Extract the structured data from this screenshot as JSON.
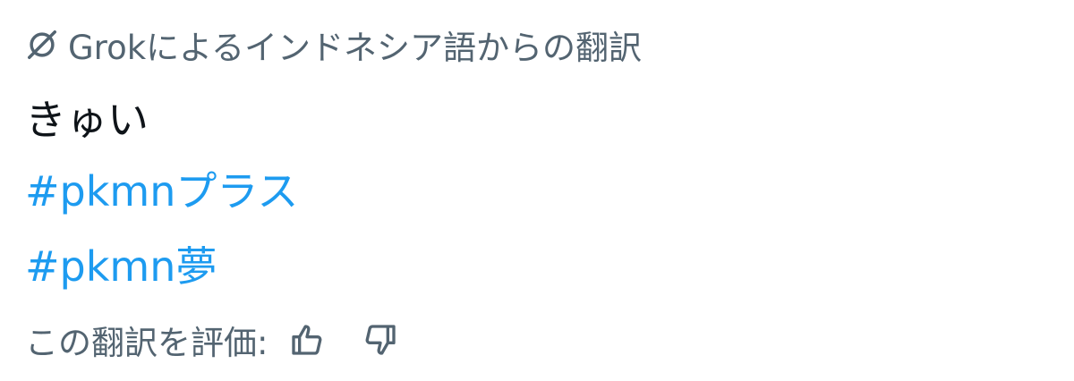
{
  "translation": {
    "header_label": "Grokによるインドネシア語からの翻訳",
    "icon": "grok-icon",
    "body_text": "きゅい",
    "hashtags": [
      "#pkmnプラス",
      "#pkmn夢"
    ],
    "rate_label": "この翻訳を評価:",
    "thumbs_up_icon": "thumbs-up-icon",
    "thumbs_down_icon": "thumbs-down-icon"
  },
  "colors": {
    "text_primary": "#0f1419",
    "text_secondary": "#536471",
    "link": "#1d9bf0",
    "background": "#ffffff"
  }
}
